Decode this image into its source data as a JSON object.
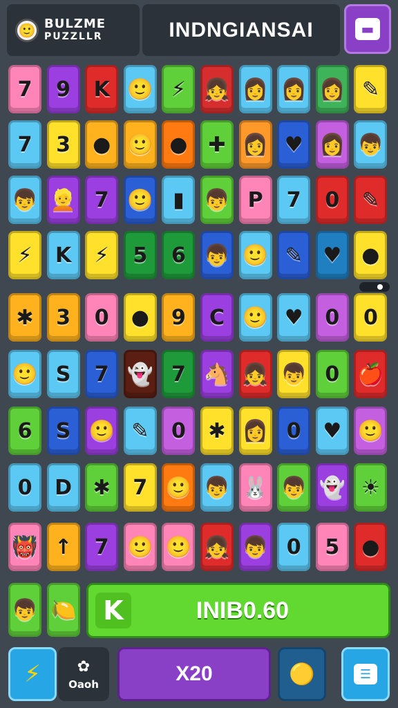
{
  "header": {
    "logo_line1": "BULZME",
    "logo_line2": "PUZZLLR",
    "title": "INDNGIANSAI",
    "avatar_icon": "🙂",
    "chat_icon": "message-icon"
  },
  "board": {
    "rows": [
      [
        {
          "g": "7",
          "c": "#ff84b8"
        },
        {
          "g": "9",
          "c": "#9b3fe0"
        },
        {
          "g": "K",
          "c": "#e02b2b"
        },
        {
          "g": "🙂",
          "c": "#5cc9f5"
        },
        {
          "g": "⚡",
          "c": "#5fd03a"
        },
        {
          "g": "👧",
          "c": "#d62e2e"
        },
        {
          "g": "👩",
          "c": "#5cc9f5"
        },
        {
          "g": "👩",
          "c": "#5cc9f5"
        },
        {
          "g": "👩",
          "c": "#3fb35a"
        },
        {
          "g": "✎",
          "c": "#ffe02a"
        }
      ],
      [
        {
          "g": "7",
          "c": "#5cc9f5"
        },
        {
          "g": "3",
          "c": "#ffe02a"
        },
        {
          "g": "●",
          "c": "#ffb21e"
        },
        {
          "g": "🙂",
          "c": "#ffb21e"
        },
        {
          "g": "●",
          "c": "#ff7a10"
        },
        {
          "g": "✚",
          "c": "#5fd03a"
        },
        {
          "g": "👩",
          "c": "#ff9a2a"
        },
        {
          "g": "♥",
          "c": "#2a5fd6"
        },
        {
          "g": "👩",
          "c": "#c45fe0"
        },
        {
          "g": "👦",
          "c": "#5cc9f5"
        }
      ],
      [
        {
          "g": "👦",
          "c": "#5cc9f5"
        },
        {
          "g": "👱",
          "c": "#9b3fe0"
        },
        {
          "g": "7",
          "c": "#9b3fe0"
        },
        {
          "g": "🙂",
          "c": "#2a5fd6"
        },
        {
          "g": "▮",
          "c": "#5cc9f5"
        },
        {
          "g": "👦",
          "c": "#5fd03a"
        },
        {
          "g": "P",
          "c": "#ff84b8"
        },
        {
          "g": "7",
          "c": "#5cc9f5"
        },
        {
          "g": "0",
          "c": "#e02b2b"
        },
        {
          "g": "✎",
          "c": "#e02b2b"
        }
      ],
      [
        {
          "g": "⚡",
          "c": "#ffe02a"
        },
        {
          "g": "K",
          "c": "#5cc9f5"
        },
        {
          "g": "⚡",
          "c": "#ffe02a"
        },
        {
          "g": "5",
          "c": "#1f9a3a"
        },
        {
          "g": "6",
          "c": "#1f9a3a"
        },
        {
          "g": "👦",
          "c": "#2a5fd6"
        },
        {
          "g": "🙂",
          "c": "#5cc9f5"
        },
        {
          "g": "✎",
          "c": "#2a5fd6"
        },
        {
          "g": "♥",
          "c": "#1f7fc0"
        },
        {
          "g": "●",
          "c": "#ffe02a"
        }
      ],
      [
        {
          "g": "✱",
          "c": "#ffb21e"
        },
        {
          "g": "3",
          "c": "#ffb21e"
        },
        {
          "g": "0",
          "c": "#ff84b8"
        },
        {
          "g": "●",
          "c": "#ffe02a"
        },
        {
          "g": "9",
          "c": "#ffb21e"
        },
        {
          "g": "C",
          "c": "#9b3fe0"
        },
        {
          "g": "🙂",
          "c": "#5cc9f5"
        },
        {
          "g": "♥",
          "c": "#5cc9f5"
        },
        {
          "g": "0",
          "c": "#c45fe0"
        },
        {
          "g": "0",
          "c": "#ffe02a"
        }
      ],
      [
        {
          "g": "🙂",
          "c": "#5cc9f5"
        },
        {
          "g": "S",
          "c": "#5cc9f5"
        },
        {
          "g": "7",
          "c": "#2a5fd6"
        },
        {
          "g": "👻",
          "c": "#5a1e12"
        },
        {
          "g": "7",
          "c": "#1f9a3a"
        },
        {
          "g": "🐴",
          "c": "#9b3fe0"
        },
        {
          "g": "👧",
          "c": "#e02b2b"
        },
        {
          "g": "👦",
          "c": "#ffe02a"
        },
        {
          "g": "0",
          "c": "#5fd03a"
        },
        {
          "g": "🍎",
          "c": "#e02b2b"
        }
      ],
      [
        {
          "g": "6",
          "c": "#5fd03a"
        },
        {
          "g": "S",
          "c": "#2a5fd6"
        },
        {
          "g": "🙂",
          "c": "#9b3fe0"
        },
        {
          "g": "✎",
          "c": "#5cc9f5"
        },
        {
          "g": "0",
          "c": "#c45fe0"
        },
        {
          "g": "✱",
          "c": "#ffe02a"
        },
        {
          "g": "👩",
          "c": "#ffe02a"
        },
        {
          "g": "0",
          "c": "#2a5fd6"
        },
        {
          "g": "♥",
          "c": "#5cc9f5"
        },
        {
          "g": "🙂",
          "c": "#c45fe0"
        }
      ],
      [
        {
          "g": "0",
          "c": "#5cc9f5"
        },
        {
          "g": "D",
          "c": "#5cc9f5"
        },
        {
          "g": "✱",
          "c": "#5fd03a"
        },
        {
          "g": "7",
          "c": "#ffe02a"
        },
        {
          "g": "🙂",
          "c": "#ff7a10"
        },
        {
          "g": "👦",
          "c": "#5cc9f5"
        },
        {
          "g": "🐰",
          "c": "#ff84b8"
        },
        {
          "g": "👦",
          "c": "#5fd03a"
        },
        {
          "g": "👻",
          "c": "#9b3fe0"
        },
        {
          "g": "☀",
          "c": "#5fd03a"
        }
      ],
      [
        {
          "g": "👹",
          "c": "#ff84b8"
        },
        {
          "g": "↑",
          "c": "#ffb21e"
        },
        {
          "g": "7",
          "c": "#9b3fe0"
        },
        {
          "g": "🙂",
          "c": "#ff84b8"
        },
        {
          "g": "🙂",
          "c": "#ff84b8"
        },
        {
          "g": "👧",
          "c": "#e02b2b"
        },
        {
          "g": "👦",
          "c": "#9b3fe0"
        },
        {
          "g": "0",
          "c": "#5cc9f5"
        },
        {
          "g": "5",
          "c": "#ff84b8"
        },
        {
          "g": "●",
          "c": "#e02b2b"
        }
      ]
    ],
    "extra_tiles": [
      {
        "g": "👦",
        "c": "#5fd03a"
      },
      {
        "g": "🍋",
        "c": "#5fd03a"
      }
    ]
  },
  "progress_bar": {
    "badge": "K",
    "value": "INIB0.60",
    "color": "#62d930"
  },
  "bottom_bar": {
    "bolt_icon": "⚡",
    "options_icon": "✿",
    "options_label": "Oaoh",
    "multiplier": "X20",
    "orb_icon": "🟡",
    "menu_icon": "menu-icon"
  }
}
